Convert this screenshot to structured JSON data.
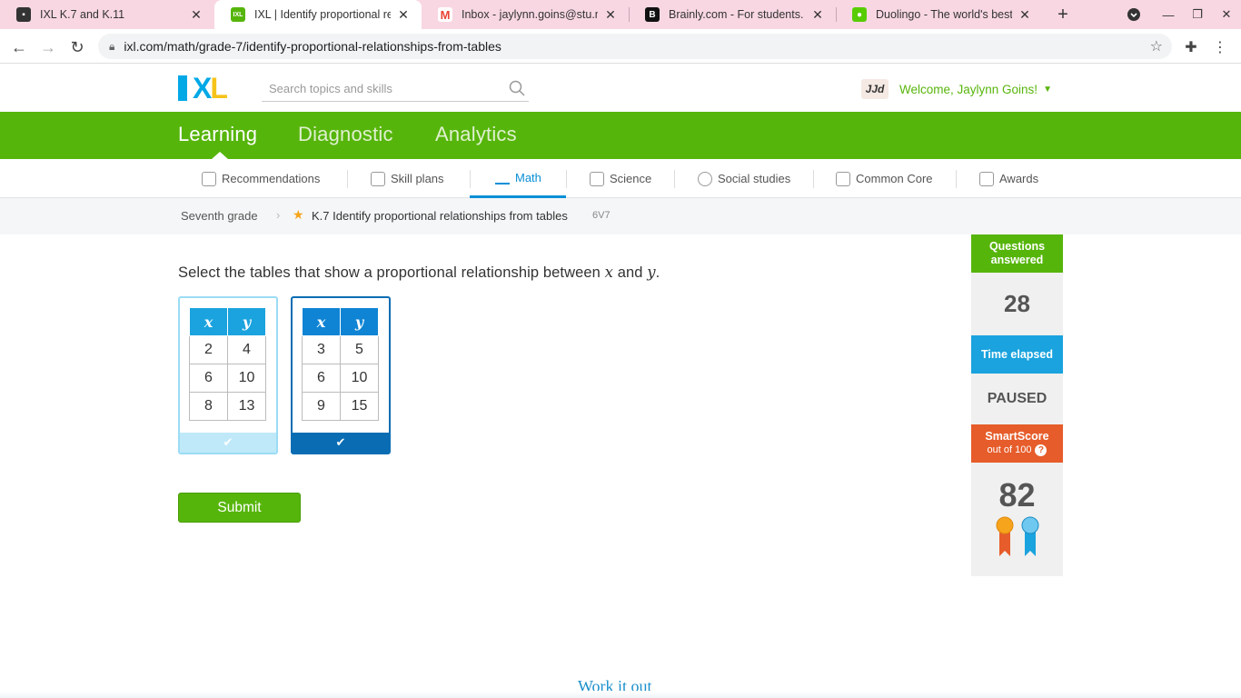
{
  "browser": {
    "tabs": [
      {
        "title": "IXL K.7 and K.11",
        "fav_color": "#333333"
      },
      {
        "title": "IXL | Identify proportional relati",
        "fav_color": "#56b50b"
      },
      {
        "title": "Inbox - jaylynn.goins@stu.mac",
        "fav_color": "#ea4335"
      },
      {
        "title": "Brainly.com - For students. By",
        "fav_color": "#111111"
      },
      {
        "title": "Duolingo - The world's best wa",
        "fav_color": "#58cc02"
      }
    ],
    "url": "ixl.com/math/grade-7/identify-proportional-relationships-from-tables"
  },
  "header": {
    "logo": "IXL",
    "search_placeholder": "Search topics and skills",
    "welcome": "Welcome, Jaylynn Goins!",
    "avatar_text": "JJd"
  },
  "main_nav": [
    "Learning",
    "Diagnostic",
    "Analytics"
  ],
  "sub_nav": [
    "Recommendations",
    "Skill plans",
    "Math",
    "Science",
    "Social studies",
    "Common Core",
    "Awards"
  ],
  "breadcrumb": {
    "grade": "Seventh grade",
    "skill": "K.7 Identify proportional relationships from tables",
    "code": "6V7"
  },
  "question": {
    "prompt_before": "Select the tables that show a proportional relationship between ",
    "var_x": "x",
    "prompt_mid": " and ",
    "var_y": "y",
    "prompt_after": ".",
    "tables": [
      {
        "headers": [
          "x",
          "y"
        ],
        "rows": [
          [
            "2",
            "4"
          ],
          [
            "6",
            "10"
          ],
          [
            "8",
            "13"
          ]
        ],
        "selected": false
      },
      {
        "headers": [
          "x",
          "y"
        ],
        "rows": [
          [
            "3",
            "5"
          ],
          [
            "6",
            "10"
          ],
          [
            "9",
            "15"
          ]
        ],
        "selected": true
      }
    ],
    "submit_label": "Submit"
  },
  "stats": {
    "questions_label": "Questions answered",
    "questions_value": "28",
    "time_label": "Time elapsed",
    "time_value": "PAUSED",
    "smartscore_label": "SmartScore",
    "smartscore_sub": "out of 100",
    "smartscore_value": "82"
  },
  "footer_link": "Work it out"
}
